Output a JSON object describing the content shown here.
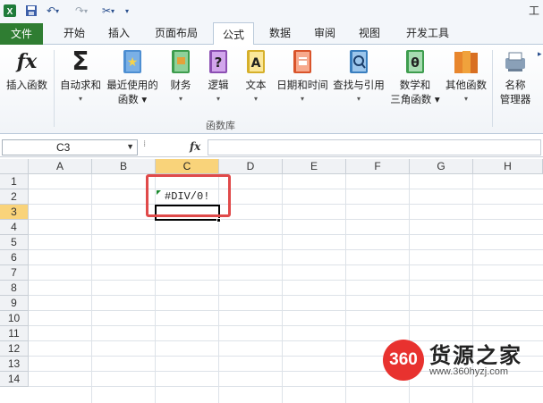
{
  "window": {
    "title_fragment": "工"
  },
  "tabs": [
    "文件",
    "开始",
    "插入",
    "页面布局",
    "公式",
    "数据",
    "审阅",
    "视图",
    "开发工具"
  ],
  "active_tab": "公式",
  "ribbon": {
    "buttons": [
      {
        "line1": "插入函数",
        "line2": "",
        "icon": "fx-icon"
      },
      {
        "line1": "自动求和",
        "line2": "▾",
        "icon": "sigma-icon"
      },
      {
        "line1": "最近使用的",
        "line2": "函数 ▾",
        "icon": "star-book-icon"
      },
      {
        "line1": "财务",
        "line2": "▾",
        "icon": "finance-book-icon"
      },
      {
        "line1": "逻辑",
        "line2": "▾",
        "icon": "logic-book-icon"
      },
      {
        "line1": "文本",
        "line2": "▾",
        "icon": "text-book-icon"
      },
      {
        "line1": "日期和时间",
        "line2": "▾",
        "icon": "date-book-icon"
      },
      {
        "line1": "查找与引用",
        "line2": "▾",
        "icon": "lookup-book-icon"
      },
      {
        "line1": "数学和",
        "line2": "三角函数 ▾",
        "icon": "theta-book-icon"
      },
      {
        "line1": "其他函数",
        "line2": "▾",
        "icon": "more-books-icon"
      },
      {
        "line1": "名称",
        "line2": "管理器",
        "icon": "name-manager-icon"
      }
    ],
    "group_label": "函数库"
  },
  "formula_bar": {
    "name_box": "C3",
    "fx_label": "fx",
    "formula": ""
  },
  "grid": {
    "columns": [
      "A",
      "B",
      "C",
      "D",
      "E",
      "F",
      "G",
      "H"
    ],
    "rows": [
      "1",
      "2",
      "3",
      "4",
      "5",
      "6",
      "7",
      "8",
      "9",
      "10",
      "11",
      "12",
      "13",
      "14"
    ],
    "selected_column": "C",
    "selected_row": "3",
    "cells": {
      "C2": "#DIV/0!"
    }
  },
  "watermark": {
    "logo": "360",
    "name": "货源之家",
    "url": "www.360hyzj.com"
  },
  "colors": {
    "file_tab": "#2f7d32",
    "highlight_box": "#e04a4a",
    "selected_header": "#f9d37a",
    "watermark_red": "#e8322f"
  }
}
